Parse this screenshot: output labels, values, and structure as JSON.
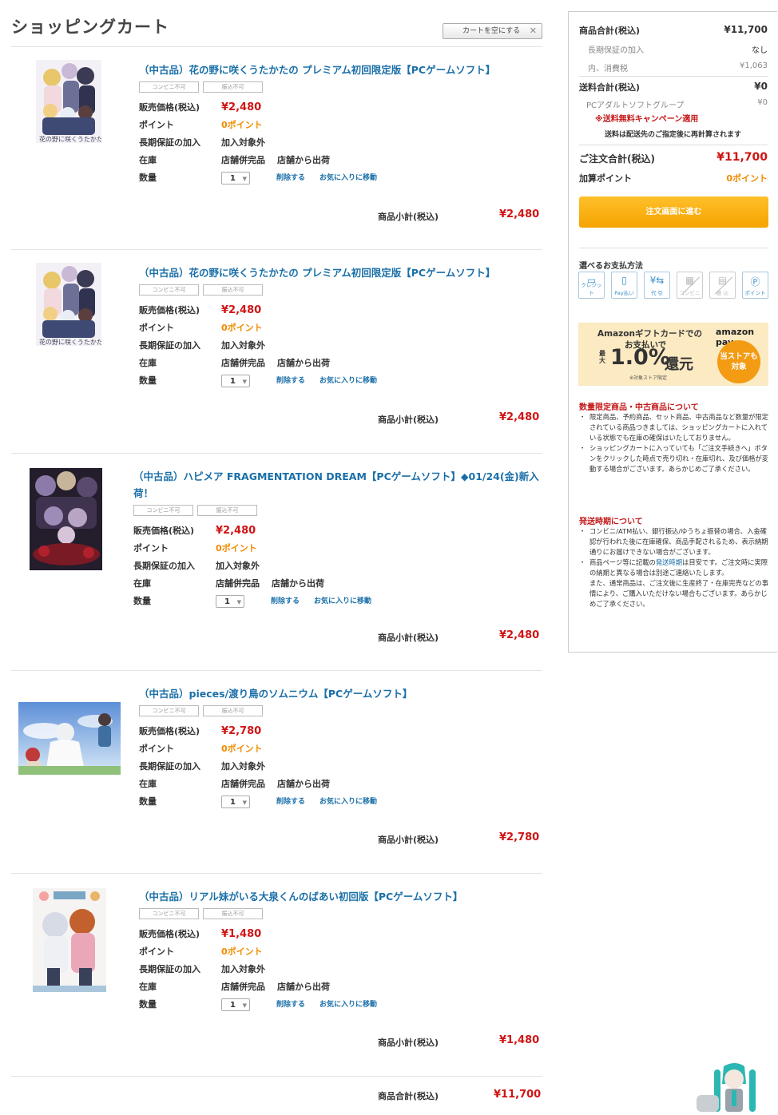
{
  "page": {
    "title": "ショッピングカート",
    "empty_cart": "カートを空にする",
    "empty_cart_icon": "close-icon"
  },
  "items": [
    {
      "title": "（中古品）花の野に咲くうたかたの プレミアム初回限定版【PCゲームソフト】",
      "badges": [
        "コンビニ不可",
        "振込不可"
      ],
      "price_label": "販売価格(税込)",
      "price": "¥2,480",
      "point_label": "ポイント",
      "points": "0ポイント",
      "warranty_label": "長期保証の加入",
      "warranty": "加入対象外",
      "stock_label": "在庫",
      "stock": "店舗併完品",
      "ship": "店舗から出荷",
      "qty_label": "数量",
      "qty": "1",
      "delete": "削除する",
      "favorite": "お気に入りに移動",
      "subtotal_label": "商品小計(税込)",
      "subtotal": "¥2,480",
      "thumb_text": "花の野に咲くうたかたの"
    },
    {
      "title": "（中古品）花の野に咲くうたかたの プレミアム初回限定版【PCゲームソフト】",
      "badges": [
        "コンビニ不可",
        "振込不可"
      ],
      "price_label": "販売価格(税込)",
      "price": "¥2,480",
      "point_label": "ポイント",
      "points": "0ポイント",
      "warranty_label": "長期保証の加入",
      "warranty": "加入対象外",
      "stock_label": "在庫",
      "stock": "店舗併完品",
      "ship": "店舗から出荷",
      "qty_label": "数量",
      "qty": "1",
      "delete": "削除する",
      "favorite": "お気に入りに移動",
      "subtotal_label": "商品小計(税込)",
      "subtotal": "¥2,480",
      "thumb_text": "花の野に咲くうたかたの"
    },
    {
      "title": "（中古品）ハピメア FRAGMENTATION DREAM【PCゲームソフト】◆01/24(金)新入荷！",
      "badges": [
        "コンビニ不可",
        "振込不可"
      ],
      "price_label": "販売価格(税込)",
      "price": "¥2,480",
      "point_label": "ポイント",
      "points": "0ポイント",
      "warranty_label": "長期保証の加入",
      "warranty": "加入対象外",
      "stock_label": "在庫",
      "stock": "店舗併完品",
      "ship": "店舗から出荷",
      "qty_label": "数量",
      "qty": "1",
      "delete": "削除する",
      "favorite": "お気に入りに移動",
      "subtotal_label": "商品小計(税込)",
      "subtotal": "¥2,480"
    },
    {
      "title": "（中古品）pieces/渡り鳥のソムニウム【PCゲームソフト】",
      "badges": [
        "コンビニ不可",
        "振込不可"
      ],
      "price_label": "販売価格(税込)",
      "price": "¥2,780",
      "point_label": "ポイント",
      "points": "0ポイント",
      "warranty_label": "長期保証の加入",
      "warranty": "加入対象外",
      "stock_label": "在庫",
      "stock": "店舗併完品",
      "ship": "店舗から出荷",
      "qty_label": "数量",
      "qty": "1",
      "delete": "削除する",
      "favorite": "お気に入りに移動",
      "subtotal_label": "商品小計(税込)",
      "subtotal": "¥2,780"
    },
    {
      "title": "（中古品）リアル妹がいる大泉くんのばあい初回版【PCゲームソフト】",
      "badges": [
        "コンビニ不可",
        "振込不可"
      ],
      "price_label": "販売価格(税込)",
      "price": "¥1,480",
      "point_label": "ポイント",
      "points": "0ポイント",
      "warranty_label": "長期保証の加入",
      "warranty": "加入対象外",
      "stock_label": "在庫",
      "stock": "店舗併完品",
      "ship": "店舗から出荷",
      "qty_label": "数量",
      "qty": "1",
      "delete": "削除する",
      "favorite": "お気に入りに移動",
      "subtotal_label": "商品小計(税込)",
      "subtotal": "¥1,480"
    }
  ],
  "grand_total": {
    "label": "商品合計(税込)",
    "value": "¥11,700"
  },
  "summary": {
    "goods_total_label": "商品合計(税込)",
    "goods_total": "¥11,700",
    "warranty_label": "長期保証の加入",
    "warranty": "なし",
    "tax_label": "内、消費税",
    "tax": "¥1,063",
    "shipping_label": "送料合計(税込)",
    "shipping": "¥0",
    "group_label": "PCアダルトソフトグループ",
    "group": "¥0",
    "campaign": "※送料無料キャンペーン適用",
    "recalc_note": "送料は配送先のご指定後に再計算されます",
    "order_total_label": "ご注文合計(税込)",
    "order_total": "¥11,700",
    "points_label": "加算ポイント",
    "points": "0ポイント",
    "order_button": "注文画面に進む"
  },
  "payment": {
    "title": "選べるお支払方法",
    "methods": [
      {
        "label": "クレジット",
        "icon": "credit-card-icon",
        "available": true
      },
      {
        "label": "Pay払い",
        "icon": "smartphone-pay-icon",
        "available": true
      },
      {
        "label": "代 引",
        "icon": "cash-on-delivery-icon",
        "available": true
      },
      {
        "label": "コンビニ",
        "icon": "convenience-store-icon",
        "available": false
      },
      {
        "label": "振 込",
        "icon": "bank-transfer-icon",
        "available": false
      },
      {
        "label": "ポイント",
        "icon": "point-icon",
        "available": true
      }
    ]
  },
  "amazon_banner": {
    "line1": "Amazonギフトカードでの",
    "line2": "お支払いで",
    "max": "最大",
    "rate": "1.0%",
    "kangen": "還元",
    "note": "※対象ストア限定",
    "logo": "amazon pay",
    "badge": "当ストアも対象"
  },
  "notices": [
    {
      "heading": "数量限定商品・中古商品について",
      "items": [
        "限定商品、予約商品、セット商品、中古商品など数量が限定されている商品つきましては、ショッピングカートに入れている状態でも在庫の確保はいたしておりません。",
        "ショッピングカートに入っていても「ご注文手続きへ」ボタンをクリックした時点で売り切れ・在庫切れ、及び価格が変動する場合がございます。あらかじめご了承ください。"
      ]
    },
    {
      "heading": "発送時期について",
      "items": [
        "コンビニ/ATM払い、銀行振込/ゆうちょ振替の場合、入金確認が行われた後に在庫確保、商品手配されるため、表示納期通りにお届けできない場合がございます。"
      ],
      "item2_pre": "商品ページ等に記載の",
      "item2_link": "発送時期",
      "item2_post": "は目安です。ご注文時に実際の納期と異なる場合は別途ご連絡いたします。",
      "item2_cont": "また、通常商品は、ご注文後に生産終了・在庫完売などの事情により、ご購入いただけない場合もございます。あらかじめご了承ください。"
    }
  ],
  "colors": {
    "link": "#1a6fa8",
    "price": "#d01515",
    "points": "#f08c00",
    "button": "#f5a300",
    "notice": "#c41a1a"
  }
}
